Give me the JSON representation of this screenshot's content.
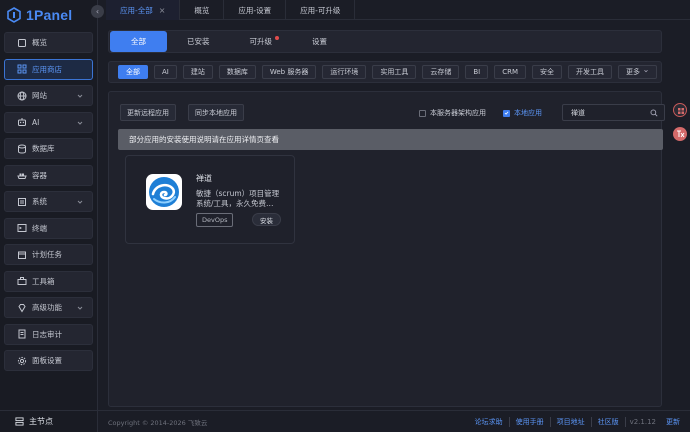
{
  "brand": {
    "name": "1Panel"
  },
  "sidebar": {
    "items": [
      {
        "label": "概览",
        "icon": "home-icon",
        "chevron": false,
        "active": false
      },
      {
        "label": "应用商店",
        "icon": "app-store-icon",
        "chevron": false,
        "active": true
      },
      {
        "label": "网站",
        "icon": "globe-icon",
        "chevron": true,
        "active": false
      },
      {
        "label": "AI",
        "icon": "robot-icon",
        "chevron": true,
        "active": false
      },
      {
        "label": "数据库",
        "icon": "database-icon",
        "chevron": false,
        "active": false
      },
      {
        "label": "容器",
        "icon": "container-icon",
        "chevron": false,
        "active": false
      },
      {
        "label": "系统",
        "icon": "system-icon",
        "chevron": true,
        "active": false
      },
      {
        "label": "终端",
        "icon": "terminal-icon",
        "chevron": false,
        "active": false
      },
      {
        "label": "计划任务",
        "icon": "calendar-icon",
        "chevron": false,
        "active": false
      },
      {
        "label": "工具箱",
        "icon": "toolbox-icon",
        "chevron": false,
        "active": false
      },
      {
        "label": "高级功能",
        "icon": "diamond-icon",
        "chevron": true,
        "active": false
      },
      {
        "label": "日志审计",
        "icon": "log-icon",
        "chevron": false,
        "active": false
      },
      {
        "label": "面板设置",
        "icon": "gear-icon",
        "chevron": false,
        "active": false
      }
    ],
    "node_label": "主节点"
  },
  "top_tabs": [
    {
      "label": "应用-全部",
      "active": true,
      "closable": true
    },
    {
      "label": "概览",
      "active": false,
      "closable": false
    },
    {
      "label": "应用-设置",
      "active": false,
      "closable": false
    },
    {
      "label": "应用-可升级",
      "active": false,
      "closable": false
    }
  ],
  "sub_tabs": [
    {
      "label": "全部",
      "active": true,
      "dot": false
    },
    {
      "label": "已安装",
      "active": false,
      "dot": false
    },
    {
      "label": "可升级",
      "active": false,
      "dot": true
    },
    {
      "label": "设置",
      "active": false,
      "dot": false
    }
  ],
  "filters": [
    {
      "label": "全部",
      "active": true
    },
    {
      "label": "AI",
      "active": false
    },
    {
      "label": "建站",
      "active": false
    },
    {
      "label": "数据库",
      "active": false
    },
    {
      "label": "Web 服务器",
      "active": false
    },
    {
      "label": "运行环境",
      "active": false
    },
    {
      "label": "实用工具",
      "active": false
    },
    {
      "label": "云存储",
      "active": false
    },
    {
      "label": "BI",
      "active": false
    },
    {
      "label": "CRM",
      "active": false
    },
    {
      "label": "安全",
      "active": false
    },
    {
      "label": "开发工具",
      "active": false
    },
    {
      "label": "更多",
      "active": false,
      "dropdown": true
    }
  ],
  "toolbar": {
    "sync_remote": "更新远程应用",
    "sync_local": "同步本地应用",
    "arch_checkbox": {
      "label": "本服务器架构应用",
      "checked": false
    },
    "local_checkbox": {
      "label": "本地应用",
      "checked": true
    },
    "search_value": "禅道"
  },
  "notice": "部分应用的安装使用说明请在应用详情页查看",
  "apps": [
    {
      "name": "禅道",
      "description": "敏捷（scrum）项目管理系统/工具，永久免费…",
      "tag": "DevOps",
      "install_label": "安装"
    }
  ],
  "footer": {
    "copyright": "Copyright © 2014-2026 飞致云",
    "links": [
      "论坛求助",
      "使用手册",
      "项目地址",
      "社区版"
    ],
    "version": "v2.1.12",
    "update": "更新"
  },
  "colors": {
    "accent": "#3f7ef0",
    "bg": "#1b1d26",
    "danger": "#e04c4c"
  }
}
